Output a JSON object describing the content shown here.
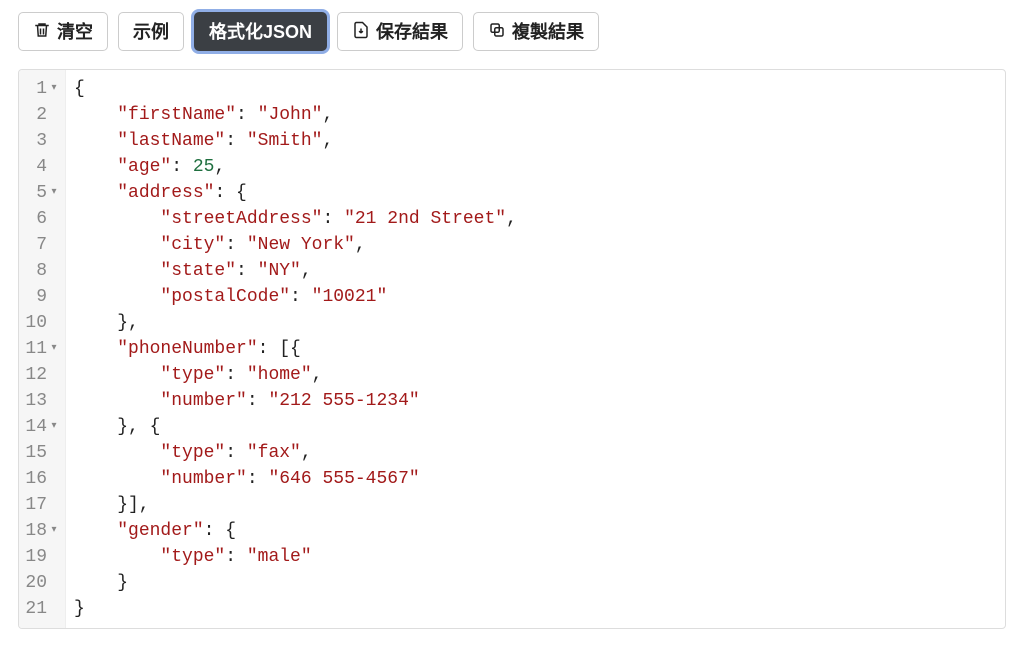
{
  "toolbar": {
    "clear": "清空",
    "example": "示例",
    "format": "格式化JSON",
    "save": "保存結果",
    "copy": "複製結果"
  },
  "editor": {
    "lines": [
      {
        "n": 1,
        "fold": true,
        "tokens": [
          {
            "t": "{",
            "c": "punct"
          }
        ]
      },
      {
        "n": 2,
        "fold": false,
        "tokens": [
          {
            "t": "    ",
            "c": "plain"
          },
          {
            "t": "\"firstName\"",
            "c": "key"
          },
          {
            "t": ": ",
            "c": "punct"
          },
          {
            "t": "\"John\"",
            "c": "string"
          },
          {
            "t": ",",
            "c": "punct"
          }
        ]
      },
      {
        "n": 3,
        "fold": false,
        "tokens": [
          {
            "t": "    ",
            "c": "plain"
          },
          {
            "t": "\"lastName\"",
            "c": "key"
          },
          {
            "t": ": ",
            "c": "punct"
          },
          {
            "t": "\"Smith\"",
            "c": "string"
          },
          {
            "t": ",",
            "c": "punct"
          }
        ]
      },
      {
        "n": 4,
        "fold": false,
        "tokens": [
          {
            "t": "    ",
            "c": "plain"
          },
          {
            "t": "\"age\"",
            "c": "key"
          },
          {
            "t": ": ",
            "c": "punct"
          },
          {
            "t": "25",
            "c": "number"
          },
          {
            "t": ",",
            "c": "punct"
          }
        ]
      },
      {
        "n": 5,
        "fold": true,
        "tokens": [
          {
            "t": "    ",
            "c": "plain"
          },
          {
            "t": "\"address\"",
            "c": "key"
          },
          {
            "t": ": {",
            "c": "punct"
          }
        ]
      },
      {
        "n": 6,
        "fold": false,
        "tokens": [
          {
            "t": "        ",
            "c": "plain"
          },
          {
            "t": "\"streetAddress\"",
            "c": "key"
          },
          {
            "t": ": ",
            "c": "punct"
          },
          {
            "t": "\"21 2nd Street\"",
            "c": "string"
          },
          {
            "t": ",",
            "c": "punct"
          }
        ]
      },
      {
        "n": 7,
        "fold": false,
        "tokens": [
          {
            "t": "        ",
            "c": "plain"
          },
          {
            "t": "\"city\"",
            "c": "key"
          },
          {
            "t": ": ",
            "c": "punct"
          },
          {
            "t": "\"New York\"",
            "c": "string"
          },
          {
            "t": ",",
            "c": "punct"
          }
        ]
      },
      {
        "n": 8,
        "fold": false,
        "tokens": [
          {
            "t": "        ",
            "c": "plain"
          },
          {
            "t": "\"state\"",
            "c": "key"
          },
          {
            "t": ": ",
            "c": "punct"
          },
          {
            "t": "\"NY\"",
            "c": "string"
          },
          {
            "t": ",",
            "c": "punct"
          }
        ]
      },
      {
        "n": 9,
        "fold": false,
        "tokens": [
          {
            "t": "        ",
            "c": "plain"
          },
          {
            "t": "\"postalCode\"",
            "c": "key"
          },
          {
            "t": ": ",
            "c": "punct"
          },
          {
            "t": "\"10021\"",
            "c": "string"
          }
        ]
      },
      {
        "n": 10,
        "fold": false,
        "tokens": [
          {
            "t": "    },",
            "c": "punct"
          }
        ]
      },
      {
        "n": 11,
        "fold": true,
        "tokens": [
          {
            "t": "    ",
            "c": "plain"
          },
          {
            "t": "\"phoneNumber\"",
            "c": "key"
          },
          {
            "t": ": [{",
            "c": "punct"
          }
        ]
      },
      {
        "n": 12,
        "fold": false,
        "tokens": [
          {
            "t": "        ",
            "c": "plain"
          },
          {
            "t": "\"type\"",
            "c": "key"
          },
          {
            "t": ": ",
            "c": "punct"
          },
          {
            "t": "\"home\"",
            "c": "string"
          },
          {
            "t": ",",
            "c": "punct"
          }
        ]
      },
      {
        "n": 13,
        "fold": false,
        "tokens": [
          {
            "t": "        ",
            "c": "plain"
          },
          {
            "t": "\"number\"",
            "c": "key"
          },
          {
            "t": ": ",
            "c": "punct"
          },
          {
            "t": "\"212 555-1234\"",
            "c": "string"
          }
        ]
      },
      {
        "n": 14,
        "fold": true,
        "tokens": [
          {
            "t": "    }, {",
            "c": "punct"
          }
        ]
      },
      {
        "n": 15,
        "fold": false,
        "tokens": [
          {
            "t": "        ",
            "c": "plain"
          },
          {
            "t": "\"type\"",
            "c": "key"
          },
          {
            "t": ": ",
            "c": "punct"
          },
          {
            "t": "\"fax\"",
            "c": "string"
          },
          {
            "t": ",",
            "c": "punct"
          }
        ]
      },
      {
        "n": 16,
        "fold": false,
        "tokens": [
          {
            "t": "        ",
            "c": "plain"
          },
          {
            "t": "\"number\"",
            "c": "key"
          },
          {
            "t": ": ",
            "c": "punct"
          },
          {
            "t": "\"646 555-4567\"",
            "c": "string"
          }
        ]
      },
      {
        "n": 17,
        "fold": false,
        "tokens": [
          {
            "t": "    }],",
            "c": "punct"
          }
        ]
      },
      {
        "n": 18,
        "fold": true,
        "tokens": [
          {
            "t": "    ",
            "c": "plain"
          },
          {
            "t": "\"gender\"",
            "c": "key"
          },
          {
            "t": ": {",
            "c": "punct"
          }
        ]
      },
      {
        "n": 19,
        "fold": false,
        "tokens": [
          {
            "t": "        ",
            "c": "plain"
          },
          {
            "t": "\"type\"",
            "c": "key"
          },
          {
            "t": ": ",
            "c": "punct"
          },
          {
            "t": "\"male\"",
            "c": "string"
          }
        ]
      },
      {
        "n": 20,
        "fold": false,
        "tokens": [
          {
            "t": "    }",
            "c": "punct"
          }
        ]
      },
      {
        "n": 21,
        "fold": false,
        "tokens": [
          {
            "t": "}",
            "c": "punct"
          }
        ]
      }
    ]
  }
}
